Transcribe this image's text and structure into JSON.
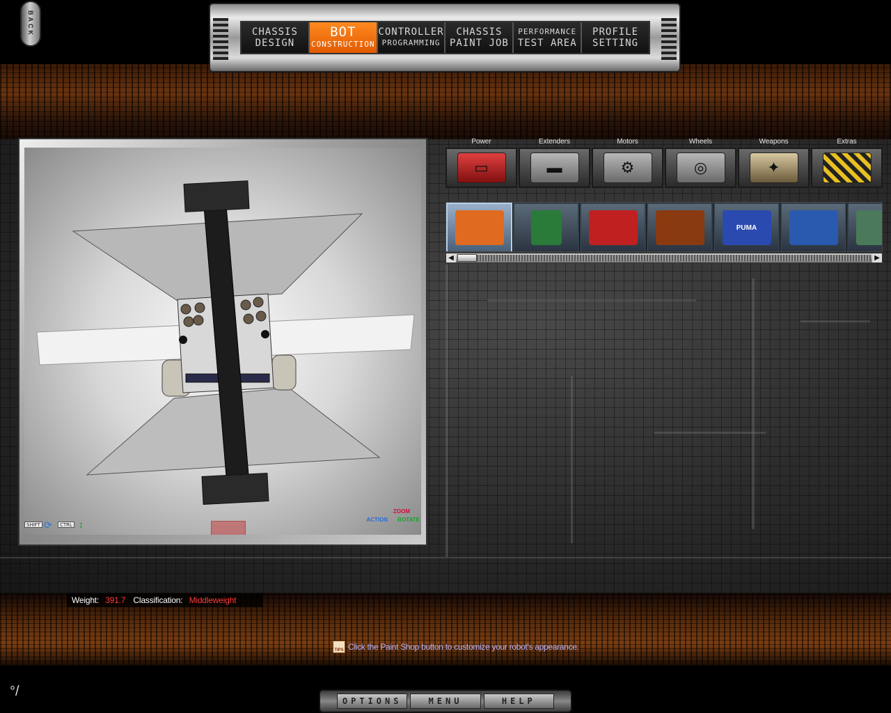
{
  "back_button": {
    "label": "BACK"
  },
  "tabs": [
    {
      "line1": "CHASSIS",
      "line2": "DESIGN",
      "active": false
    },
    {
      "line1": "BOT",
      "line2": "CONSTRUCTION",
      "active": true
    },
    {
      "line1": "CONTROLLER",
      "line2": "PROGRAMMING",
      "active": false
    },
    {
      "line1": "CHASSIS",
      "line2": "PAINT JOB",
      "active": false
    },
    {
      "line1": "PERFORMANCE",
      "line2": "TEST AREA",
      "active": false
    },
    {
      "line1": "PROFILE",
      "line2": "SETTING",
      "active": false
    }
  ],
  "viewport": {
    "shift_key": "SHIFT",
    "ctrl_key": "CTRL",
    "zoom_label": "ZOOM",
    "action_label": "ACTION",
    "rotate_label": "ROTATE"
  },
  "categories": [
    {
      "label": "Power",
      "icon": "battery-icon"
    },
    {
      "label": "Extenders",
      "icon": "extender-bar-icon"
    },
    {
      "label": "Motors",
      "icon": "motor-icon"
    },
    {
      "label": "Wheels",
      "icon": "wheel-icon"
    },
    {
      "label": "Weapons",
      "icon": "weapon-blade-icon"
    },
    {
      "label": "Extras",
      "icon": "extras-hazard-icon"
    }
  ],
  "parts": [
    {
      "icon": "battery-pack-orange-icon",
      "color": "#e06a20",
      "text": "",
      "selected": true
    },
    {
      "icon": "circuit-board-icon",
      "color": "#2a7a3a",
      "text": "",
      "selected": false
    },
    {
      "icon": "battery-red-icon",
      "color": "#c02020",
      "text": "",
      "selected": false
    },
    {
      "icon": "battery-cells-icon",
      "color": "#8a3a10",
      "text": "",
      "selected": false
    },
    {
      "icon": "puma-battery-icon",
      "color": "#2a4ab0",
      "text": "PUMA",
      "selected": false
    },
    {
      "icon": "battery-blue-icon",
      "color": "#2a5ab0",
      "text": "",
      "selected": false
    },
    {
      "icon": "battery-partial-icon",
      "color": "#4a7a5a",
      "text": "",
      "selected": false
    }
  ],
  "status": {
    "weight_label": "Weight:",
    "weight_value": "391.7",
    "class_label": "Classification:",
    "class_value": "Middleweight"
  },
  "tip": {
    "icon_text": "TIPS",
    "text": "Click the Paint Shop button to customize your robot's appearance."
  },
  "bottom_buttons": [
    "OPTIONS",
    "MENU",
    "HELP"
  ],
  "colors": {
    "accent_tab": "#f0701a",
    "status_value": "#ff3b3b",
    "tip_text": "#b8b4ff"
  }
}
